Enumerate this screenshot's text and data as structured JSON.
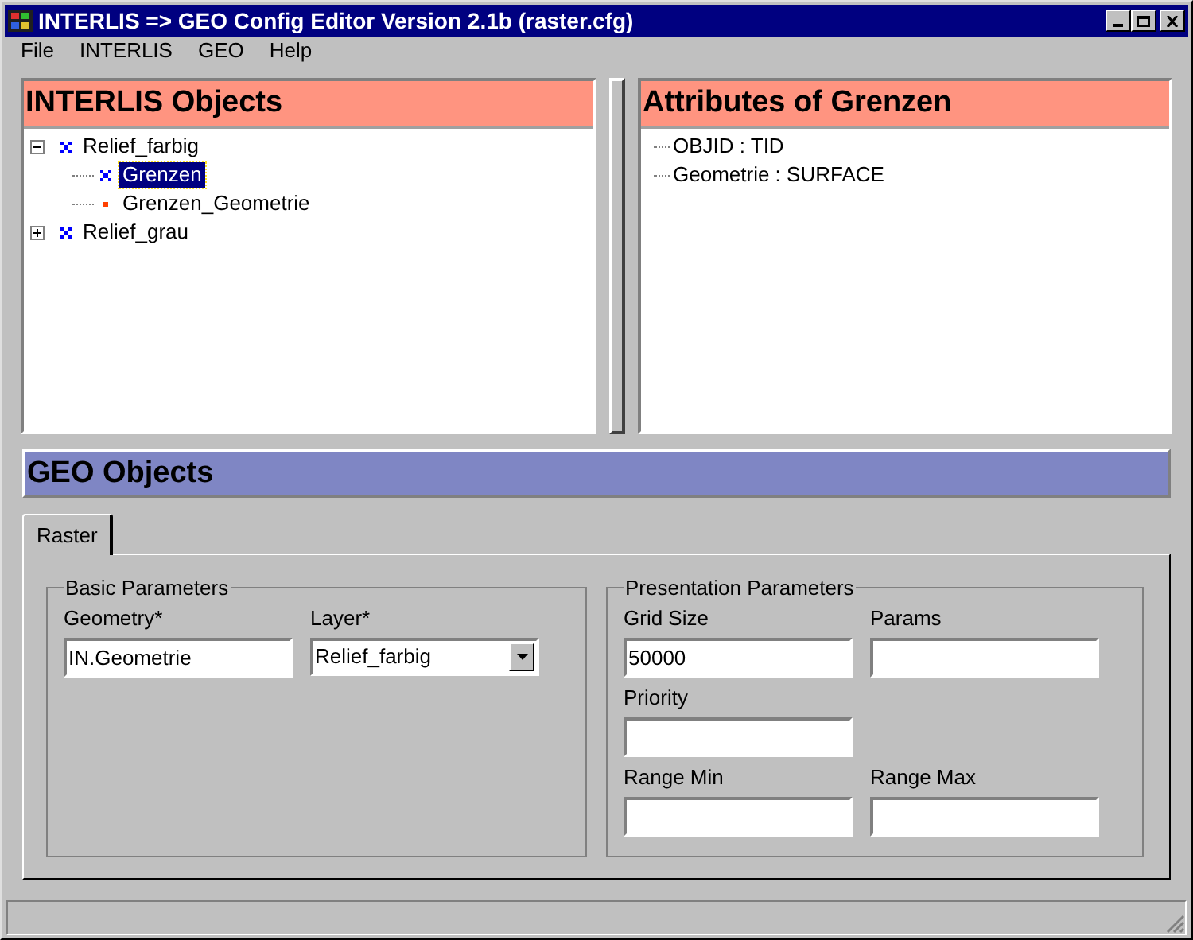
{
  "window": {
    "title": "INTERLIS => GEO Config Editor Version 2.1b (raster.cfg)"
  },
  "menu": [
    "File",
    "INTERLIS",
    "GEO",
    "Help"
  ],
  "interlis_objects": {
    "title": "INTERLIS Objects",
    "tree": [
      {
        "label": "Relief_farbig",
        "kind": "class",
        "expanded": true,
        "selected": false,
        "children": [
          {
            "label": "Grenzen",
            "kind": "class",
            "selected": true
          },
          {
            "label": "Grenzen_Geometrie",
            "kind": "attribute",
            "selected": false
          }
        ]
      },
      {
        "label": "Relief_grau",
        "kind": "class",
        "expanded": false,
        "selected": false
      }
    ]
  },
  "attributes": {
    "title": "Attributes of Grenzen",
    "items": [
      "OBJID : TID",
      "Geometrie : SURFACE"
    ]
  },
  "geo_objects": {
    "title": "GEO Objects"
  },
  "tabs": [
    {
      "label": "Raster",
      "selected": true
    }
  ],
  "groups": [
    {
      "title": "Basic Parameters",
      "fields": [
        {
          "label": "Geometry*",
          "kind": "text",
          "value": "IN.Geometrie"
        },
        {
          "label": "Layer*",
          "kind": "dropdown",
          "value": "Relief_farbig"
        }
      ]
    },
    {
      "title": "Presentation Parameters",
      "fields": [
        {
          "label": "Grid Size",
          "kind": "text",
          "value": "50000"
        },
        {
          "label": "Params",
          "kind": "text"
        },
        {
          "label": "Priority",
          "kind": "text"
        },
        {
          "kind": "empty"
        },
        {
          "label": "Range Min",
          "kind": "text"
        },
        {
          "label": "Range Max",
          "kind": "text"
        }
      ]
    }
  ]
}
